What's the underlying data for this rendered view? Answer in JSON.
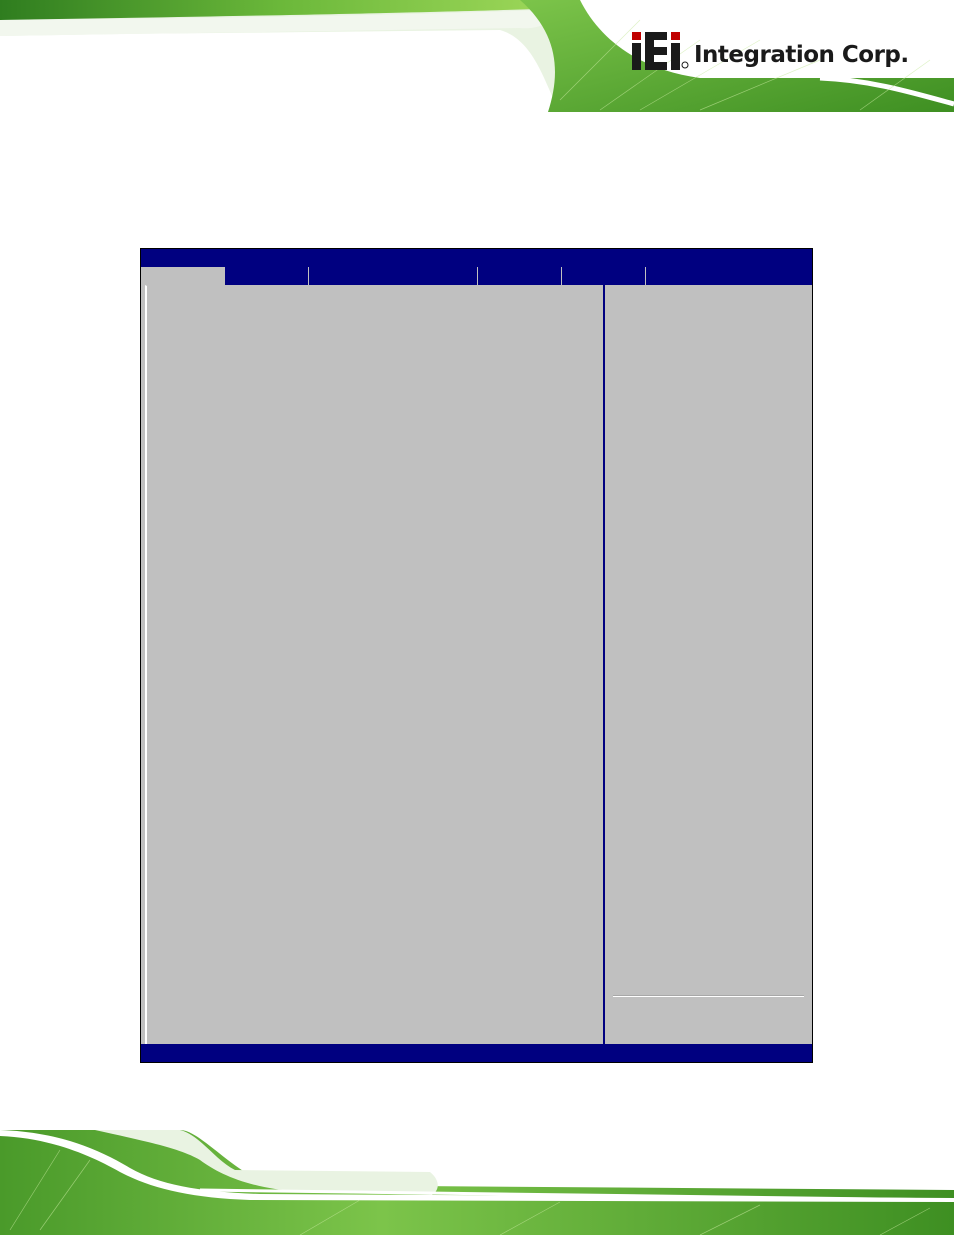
{
  "brand": {
    "logo_letters": "iEi",
    "name": "Integration Corp."
  },
  "bios": {
    "title": "",
    "tabs": [
      {
        "label": ""
      },
      {
        "label": ""
      },
      {
        "label": ""
      },
      {
        "label": ""
      },
      {
        "label": ""
      },
      {
        "label": ""
      }
    ],
    "status": ""
  },
  "colors": {
    "bios_blue": "#000080",
    "bios_gray": "#c0c0c0",
    "brand_green": "#5aa02c",
    "logo_red": "#c00000"
  }
}
